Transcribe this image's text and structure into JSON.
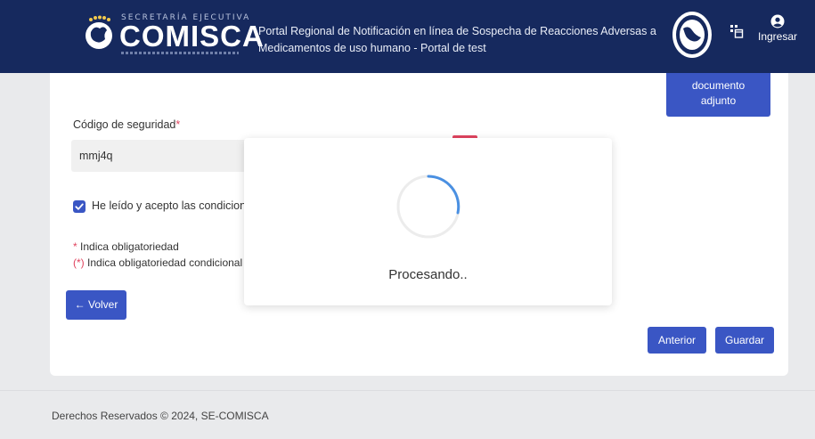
{
  "header": {
    "logo_top_text": "SECRETARÍA EJECUTIVA",
    "logo_main_text": "COMISCA",
    "portal_title_line1": "Portal Regional de Notificación en línea de Sospecha de Reacciones Adversas a",
    "portal_title_line2": "Medicamentos de uso humano - Portal de test",
    "login_label": "Ingresar"
  },
  "form": {
    "document_button_line1": "documento",
    "document_button_line2": "adjunto",
    "security_code_label": "Código de seguridad",
    "required_mark": "*",
    "security_code_value": "mmj4q",
    "terms_checked": true,
    "terms_label": "He leído y acepto las condiciones",
    "note_required_mark": "*",
    "note_required": "Indica obligatoriedad",
    "note_conditional_mark": "(*)",
    "note_conditional": "Indica obligatoriedad condicional",
    "back_button": "← Volver",
    "previous_button": "Anterior",
    "save_button": "Guardar"
  },
  "modal": {
    "processing_text": "Procesando.."
  },
  "footer": {
    "copyright": "Derechos Reservados © 2024, SE-COMISCA"
  },
  "colors": {
    "header_bg": "#16295e",
    "primary": "#3a56c4",
    "required": "#e0445f",
    "spinner": "#4a90e2"
  }
}
